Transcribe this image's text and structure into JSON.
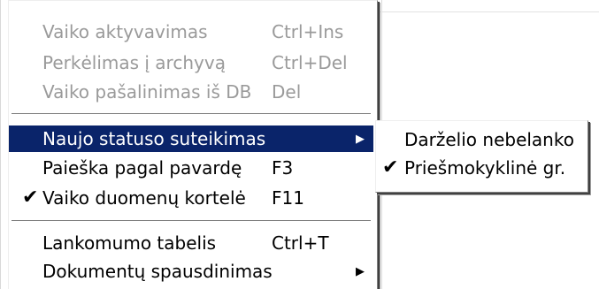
{
  "menu": {
    "items": [
      {
        "label": "Vaiko aktyvavimas",
        "shortcut": "Ctrl+Ins",
        "enabled": false
      },
      {
        "label": "Perkėlimas į archyvą",
        "shortcut": "Ctrl+Del",
        "enabled": false
      },
      {
        "label": "Vaiko pašalinimas iš DB",
        "shortcut": "Del",
        "enabled": false
      },
      {
        "label": "Naujo statuso suteikimas",
        "shortcut": "",
        "enabled": true,
        "submenu": true,
        "highlighted": true
      },
      {
        "label": "Paieška pagal pavardę",
        "shortcut": "F3",
        "enabled": true
      },
      {
        "label": "Vaiko duomenų kortelė",
        "shortcut": "F11",
        "enabled": true,
        "checked": true
      },
      {
        "label": "Lankomumo tabelis",
        "shortcut": "Ctrl+T",
        "enabled": true
      },
      {
        "label": "Dokumentų spausdinimas",
        "shortcut": "",
        "enabled": true,
        "submenu": true
      }
    ]
  },
  "submenu": {
    "items": [
      {
        "label": "Darželio nebelanko",
        "checked": false
      },
      {
        "label": "Priešmokyklinė gr.",
        "checked": true
      }
    ]
  },
  "icons": {
    "check": "checkmark-icon",
    "submenu_arrow": "submenu-arrow-icon"
  },
  "colors": {
    "highlight": "#0a246a",
    "highlight_text": "#ffffff",
    "disabled_text": "#9a9a9a"
  }
}
